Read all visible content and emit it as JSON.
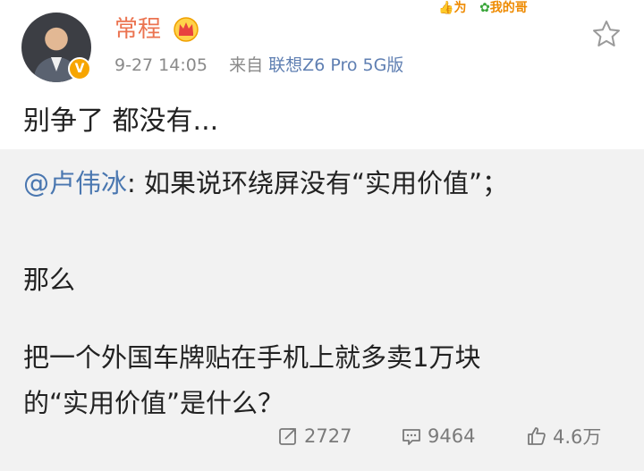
{
  "header": {
    "username": "常程",
    "timestamp": "9-27 14:05",
    "source_prefix": "来自",
    "source_device": "联想Z6 Pro 5G版",
    "badge_text_a": "为",
    "badge_text_b": "我的哥"
  },
  "post": {
    "text": "别争了 都没有..."
  },
  "repost": {
    "mention": "@卢伟冰",
    "line1_rest": ": 如果说环绕屏没有“实用价值”；",
    "line2": "那么",
    "line3": "把一个外国车牌贴在手机上就多卖1万块",
    "line4": "的“实用价值”是什么？"
  },
  "actions": {
    "repost_count": "2727",
    "comment_count": "9464",
    "like_count": "4.6万"
  },
  "colors": {
    "username": "#eb7350",
    "link": "#5f7fb2",
    "mention": "#4a77b0",
    "repost_bg": "#f2f2f2",
    "verified": "#f7a500"
  }
}
